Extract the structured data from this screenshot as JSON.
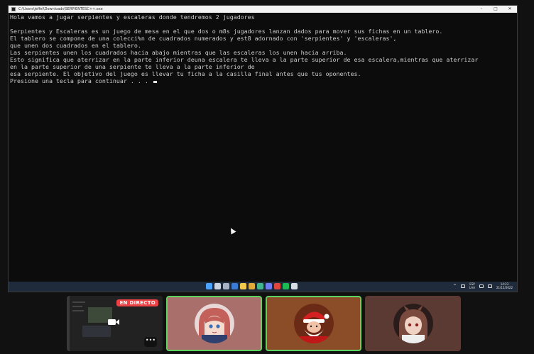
{
  "window": {
    "title": "C:\\Users\\jeffel\\Downloads\\SERPIENTESC++.exe",
    "minimize_icon": "minimize-icon",
    "maximize_icon": "maximize-icon",
    "close_icon": "close-icon"
  },
  "console": {
    "lines": [
      "Hola vamos a jugar serpientes y escaleras donde tendremos 2 jugadores",
      "",
      "Serpientes y Escaleras es un juego de mesa en el que dos o m8s jugadores lanzan dados para mover sus fichas en un tablero.",
      "El tablero se compone de una colecci%n de cuadrados numerados y est8 adornado con 'serpientes' y 'escaleras',",
      "que unen dos cuadrados en el tablero.",
      "Las serpientes unen los cuadrados hacia abajo mientras que las escaleras los unen hacia arriba.",
      "Esto significa que aterrizar en la parte inferior deuna escalera te lleva a la parte superior de esa escalera,mientras que aterrizar",
      "en la parte superior de una serpiente te lleva a la parte inferior de",
      "esa serpiente. El objetivo del juego es llevar tu ficha a la casilla final antes que tus oponentes.",
      "Presione una tecla para continuar . . . "
    ]
  },
  "taskbar": {
    "icons": [
      {
        "name": "windows-start-icon",
        "color": "#4aa3ff"
      },
      {
        "name": "search-icon",
        "color": "#c9d3e0"
      },
      {
        "name": "task-view-icon",
        "color": "#a7b3c4"
      },
      {
        "name": "mail-icon",
        "color": "#3a7bd5"
      },
      {
        "name": "file-explorer-icon",
        "color": "#f2c94c"
      },
      {
        "name": "chrome-icon",
        "color": "#e0a93a"
      },
      {
        "name": "edge-icon",
        "color": "#3fb68b"
      },
      {
        "name": "discord-icon",
        "color": "#6f7df2"
      },
      {
        "name": "app-icon",
        "color": "#e0463e"
      },
      {
        "name": "spotify-icon",
        "color": "#1db954"
      },
      {
        "name": "terminal-icon",
        "color": "#d7dde5"
      }
    ],
    "language": "ESP",
    "language_sub": "LAA",
    "time": "14:23",
    "date": "21/12/2022"
  },
  "call": {
    "live_label": "EN DIRECTO",
    "more_label": "•••",
    "participants": [
      {
        "name": "participant-1",
        "avatar": "anime-girl-avatar",
        "speaking": true
      },
      {
        "name": "participant-2",
        "avatar": "santa-avatar",
        "speaking": true
      },
      {
        "name": "participant-3",
        "avatar": "anime-character-avatar",
        "speaking": false
      }
    ]
  }
}
